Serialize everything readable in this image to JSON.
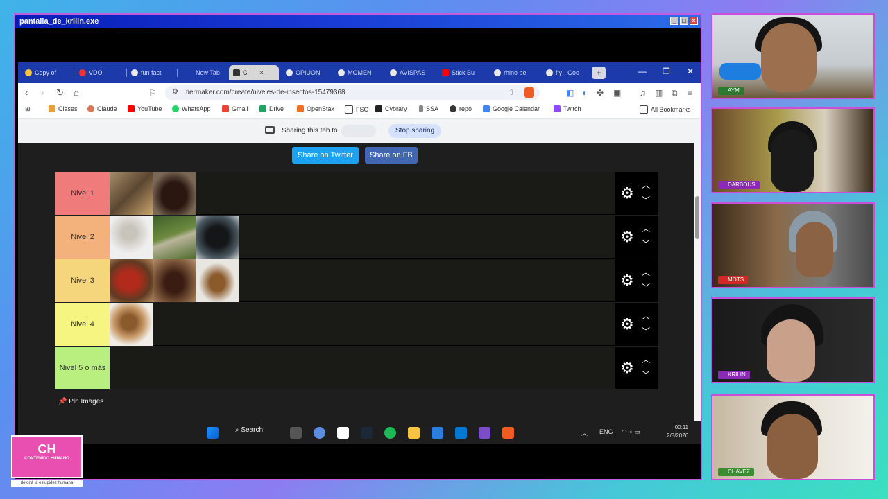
{
  "window": {
    "title": "pantalla_de_krilin.exe"
  },
  "browser": {
    "tabs": [
      {
        "label": "Copy of",
        "icon": "doc-icon"
      },
      {
        "label": "VDO",
        "icon": "vdo-icon"
      },
      {
        "label": "fun fact",
        "icon": "chrome-icon"
      },
      {
        "label": "New Tab",
        "icon": "chrome-icon"
      },
      {
        "label": "C",
        "icon": "tiermaker-icon",
        "active": true
      },
      {
        "label": "OPIUON",
        "icon": "chrome-icon"
      },
      {
        "label": "MOMEN",
        "icon": "chrome-icon"
      },
      {
        "label": "AVISPAS",
        "icon": "chrome-icon"
      },
      {
        "label": "Stick Bu",
        "icon": "youtube-icon"
      },
      {
        "label": "rhino be",
        "icon": "chrome-icon"
      },
      {
        "label": "fly - Goo",
        "icon": "chrome-icon"
      }
    ],
    "url": "tiermaker.com/create/niveles-de-insectos-15479368",
    "bookmarks": [
      {
        "label": "Clases",
        "color": "#e8a03a"
      },
      {
        "label": "Claude",
        "color": "#d97757"
      },
      {
        "label": "YouTube",
        "color": "#ff0000"
      },
      {
        "label": "WhatsApp",
        "color": "#25d366"
      },
      {
        "label": "Gmail",
        "color": "#ea4335"
      },
      {
        "label": "Drive",
        "color": "#1fa463"
      },
      {
        "label": "OpenStax",
        "color": "#f37021"
      },
      {
        "label": "FSO",
        "color": "#444444"
      },
      {
        "label": "Cybrary",
        "color": "#222222"
      },
      {
        "label": "SSA",
        "color": "#555555"
      },
      {
        "label": "repo",
        "color": "#333333"
      },
      {
        "label": "Google Calendar",
        "color": "#4285f4"
      },
      {
        "label": "Twitch",
        "color": "#9146ff"
      }
    ],
    "all_bookmarks": "All Bookmarks"
  },
  "sharing": {
    "text": "Sharing this tab to",
    "stop": "Stop sharing"
  },
  "tiermaker": {
    "share_twitter": "Share on Twitter",
    "share_fb": "Share on FB",
    "pin_images": "Pin Images",
    "tiers": [
      {
        "label": "Nivel 1",
        "color": "#f07b7b",
        "items": [
          "wasp",
          "rhino-beetle"
        ]
      },
      {
        "label": "Nivel 2",
        "color": "#f3b27c",
        "items": [
          "spider",
          "stick-bug",
          "fly"
        ]
      },
      {
        "label": "Nivel 3",
        "color": "#f6d67c",
        "items": [
          "red-ant",
          "tarantula",
          "scorpion"
        ]
      },
      {
        "label": "Nivel 4",
        "color": "#f7f582",
        "items": [
          "snail"
        ]
      },
      {
        "label": "Nivel 5 o más",
        "color": "#b8ef7f",
        "items": []
      }
    ]
  },
  "taskbar": {
    "search": "Search",
    "lang": "ENG",
    "time": "00:11",
    "date": "2/8/2026"
  },
  "cams": [
    {
      "name": "AYM",
      "tag": "green"
    },
    {
      "name": "DARBOUS",
      "tag": "purple"
    },
    {
      "name": "MOTS",
      "tag": "red"
    },
    {
      "name": "KRILIN",
      "tag": "purple"
    },
    {
      "name": "CHAVEZ",
      "tag": "green2"
    }
  ],
  "logo": {
    "text": "CH",
    "sub": "CONTENIDO HUMANO",
    "tagline": "detoná la estupidez humana"
  }
}
